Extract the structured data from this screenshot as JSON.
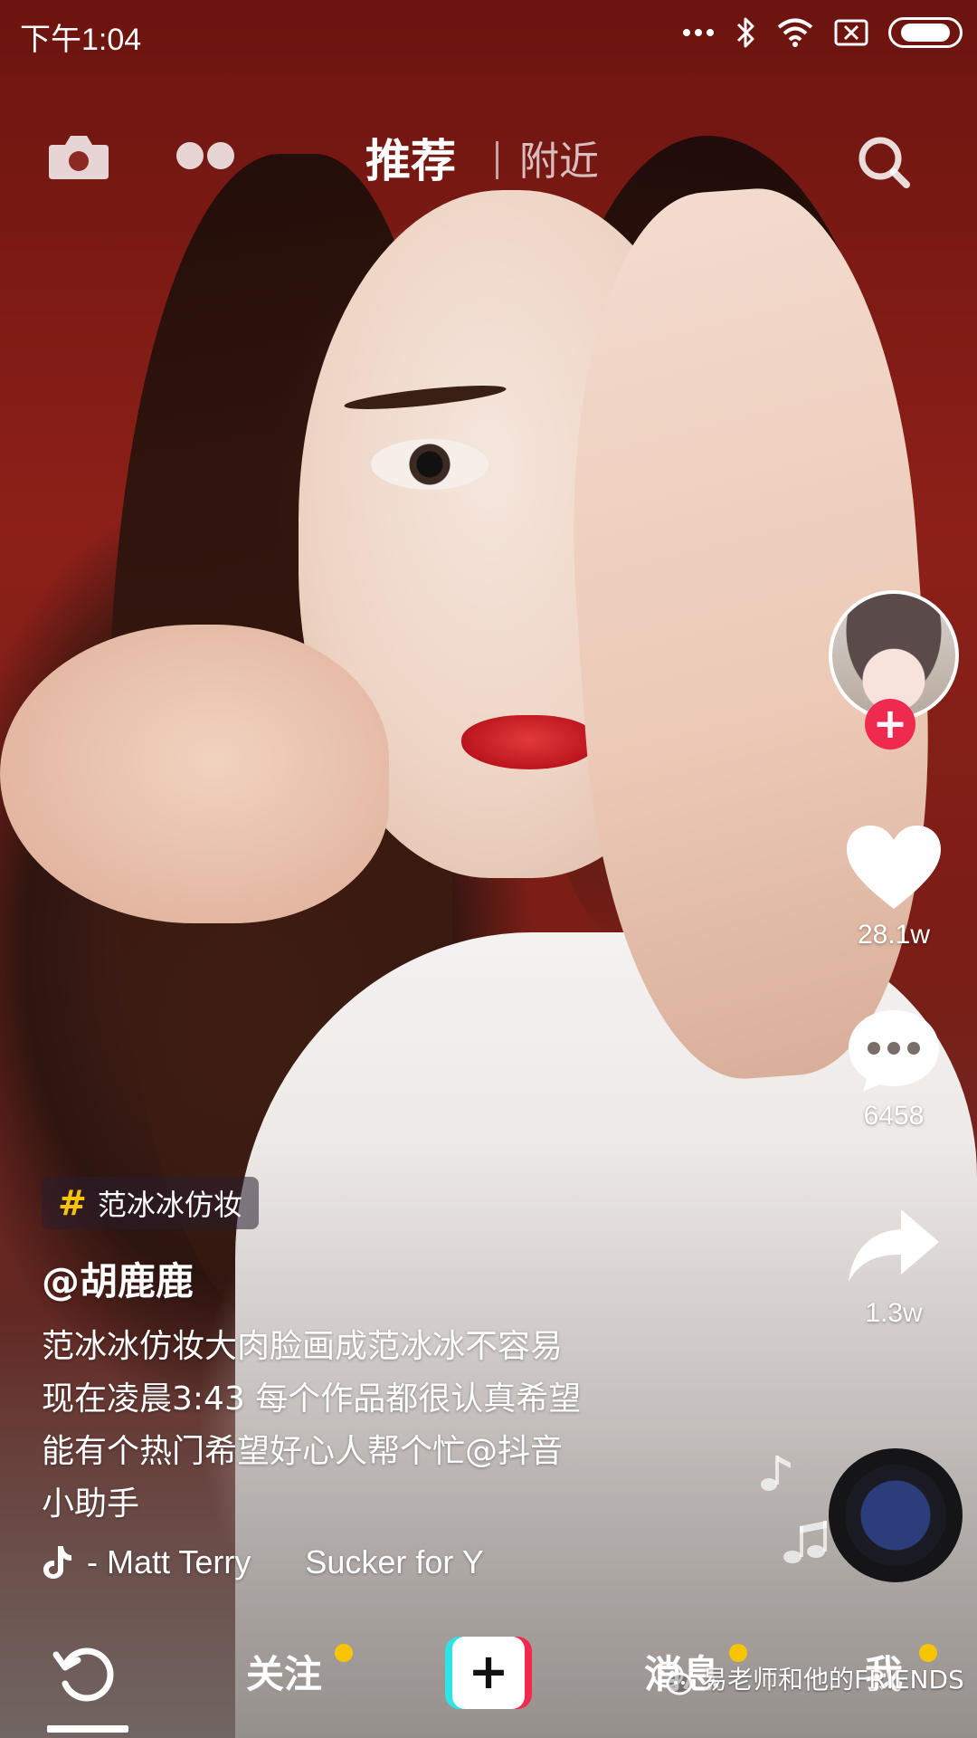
{
  "status_bar": {
    "time": "下午1:04",
    "icons": [
      "more-dots-icon",
      "bluetooth-icon",
      "wifi-icon",
      "sim-off-icon",
      "battery-icon"
    ]
  },
  "top_nav": {
    "tabs": [
      {
        "label": "推荐",
        "active": true
      },
      {
        "label": "附近",
        "active": false
      }
    ],
    "icons": [
      "camera-icon",
      "dual-dots-icon",
      "search-icon"
    ]
  },
  "video": {
    "hashtag": "范冰冰仿妆",
    "author": "@胡鹿鹿",
    "description_lines": [
      "范冰冰仿妆大肉脸画成范冰冰不容易",
      "现在凌晨3:43 每个作品都很认真希望",
      "能有个热门希望好心人帮个忙@抖音",
      "小助手"
    ],
    "music_artist": "- Matt Terry",
    "music_title": "Sucker for Y"
  },
  "actions": {
    "likes": "28.1w",
    "comments": "6458",
    "shares": "1.3w",
    "follow_symbol": "+"
  },
  "bottom_nav": {
    "items": [
      {
        "label": "",
        "icon": "refresh-icon",
        "active": true
      },
      {
        "label": "关注",
        "badge": true
      },
      {
        "label": "+",
        "icon": "create-button"
      },
      {
        "label": "消息",
        "badge": true
      },
      {
        "label": "我",
        "badge": true
      }
    ]
  },
  "watermark": {
    "text": "易老师和他的FRIENDS"
  },
  "colors": {
    "accent_red": "#f0294f",
    "accent_cyan": "#30e3e6",
    "badge_yellow": "#f7c500"
  }
}
